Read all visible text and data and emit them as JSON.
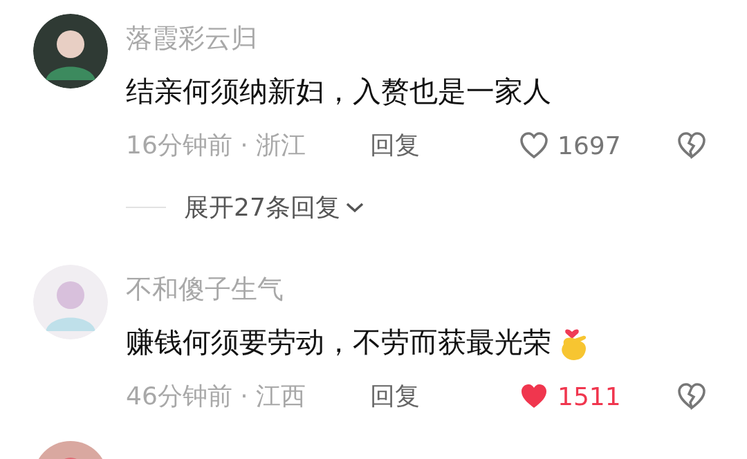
{
  "comments": [
    {
      "username": "落霞彩云归",
      "text": "结亲何须纳新妇，入赘也是一家人",
      "sticker": false,
      "time": "16分钟前 · 浙江",
      "reply": "回复",
      "likes": "1697",
      "liked": false,
      "expand": "展开27条回复"
    },
    {
      "username": "不和傻子生气",
      "text": "赚钱何须要劳动，不劳而获最光荣",
      "sticker": true,
      "time": "46分钟前 · 江西",
      "reply": "回复",
      "likes": "1511",
      "liked": true
    },
    {
      "kind": "picture"
    }
  ]
}
